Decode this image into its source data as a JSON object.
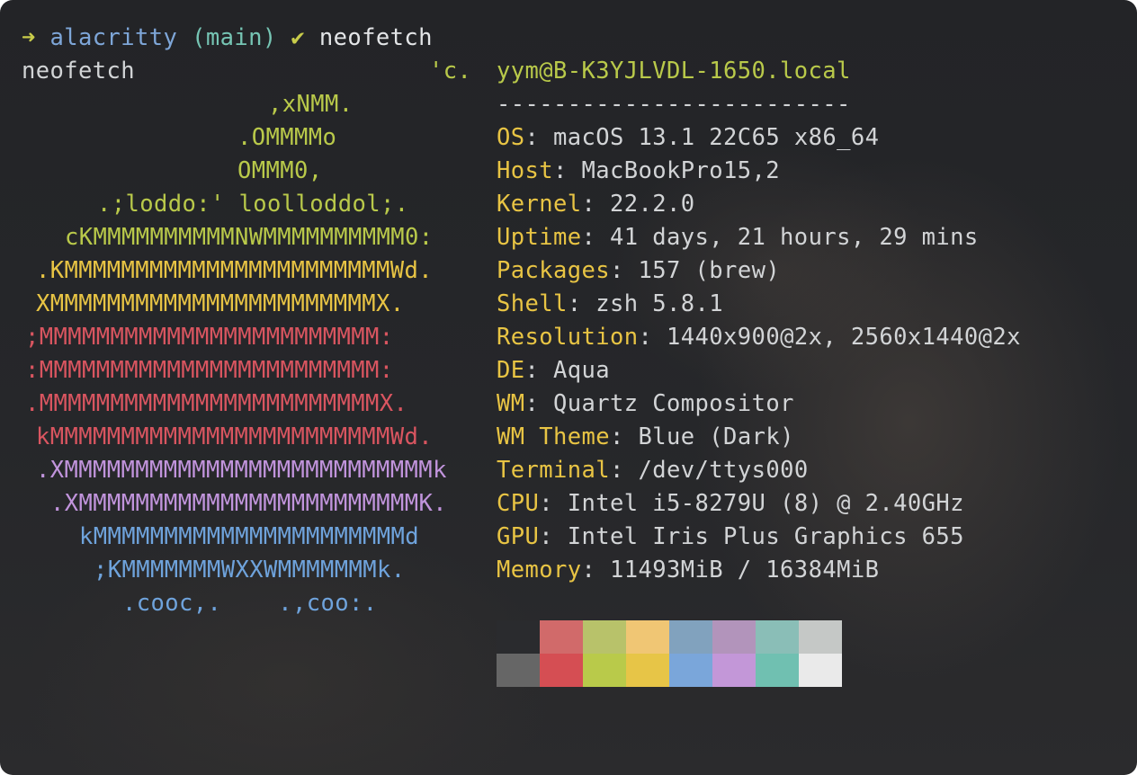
{
  "prompt": {
    "arrow": "➜",
    "directory": "alacritty",
    "branch": "(main)",
    "check": "✔",
    "command": "neofetch"
  },
  "echo_line": "neofetch",
  "ascii_art": [
    {
      "text": "'c.",
      "color": "green"
    },
    {
      "text": ",xNMM.",
      "color": "green"
    },
    {
      "text": ".OMMMMo",
      "color": "green"
    },
    {
      "text": "OMMM0,",
      "color": "green"
    },
    {
      "text": ".;loddo:' loolloddol;.",
      "color": "green"
    },
    {
      "text": "cKMMMMMMMMMMNWMMMMMMMMMM0:",
      "color": "green"
    },
    {
      "text": ".KMMMMMMMMMMMMMMMMMMMMMMMWd.",
      "color": "yellow"
    },
    {
      "text": "XMMMMMMMMMMMMMMMMMMMMMMMX.",
      "color": "yellow"
    },
    {
      "text": ";MMMMMMMMMMMMMMMMMMMMMMMM:",
      "color": "red"
    },
    {
      "text": ":MMMMMMMMMMMMMMMMMMMMMMMM:",
      "color": "red"
    },
    {
      "text": ".MMMMMMMMMMMMMMMMMMMMMMMMX.",
      "color": "red"
    },
    {
      "text": "kMMMMMMMMMMMMMMMMMMMMMMMMWd.",
      "color": "red"
    },
    {
      "text": ".XMMMMMMMMMMMMMMMMMMMMMMMMMMk",
      "color": "purple"
    },
    {
      "text": ".XMMMMMMMMMMMMMMMMMMMMMMMMK.",
      "color": "purple"
    },
    {
      "text": "kMMMMMMMMMMMMMMMMMMMMMMd",
      "color": "blue"
    },
    {
      "text": ";KMMMMMMMWXXWMMMMMMMk.",
      "color": "blue"
    },
    {
      "text": ".cooc,.    .,coo:.",
      "color": "blue"
    }
  ],
  "info": {
    "user_host": "yym@B-K3YJLVDL-1650.local",
    "separator": "-------------------------",
    "fields": [
      {
        "key": "OS",
        "value": "macOS 13.1 22C65 x86_64"
      },
      {
        "key": "Host",
        "value": "MacBookPro15,2"
      },
      {
        "key": "Kernel",
        "value": "22.2.0"
      },
      {
        "key": "Uptime",
        "value": "41 days, 21 hours, 29 mins"
      },
      {
        "key": "Packages",
        "value": "157 (brew)"
      },
      {
        "key": "Shell",
        "value": "zsh 5.8.1"
      },
      {
        "key": "Resolution",
        "value": "1440x900@2x, 2560x1440@2x"
      },
      {
        "key": "DE",
        "value": "Aqua"
      },
      {
        "key": "WM",
        "value": "Quartz Compositor"
      },
      {
        "key": "WM Theme",
        "value": "Blue (Dark)"
      },
      {
        "key": "Terminal",
        "value": "/dev/ttys000"
      },
      {
        "key": "CPU",
        "value": "Intel i5-8279U (8) @ 2.40GHz"
      },
      {
        "key": "GPU",
        "value": "Intel Iris Plus Graphics 655"
      },
      {
        "key": "Memory",
        "value": "11493MiB / 16384MiB"
      }
    ]
  },
  "palette": {
    "top": [
      "#2a2b2e",
      "#d16a6a",
      "#b8c26a",
      "#f0c674",
      "#81a2be",
      "#b294bb",
      "#8abeb7",
      "#c5c8c6"
    ],
    "bottom": [
      "#666666",
      "#d54e53",
      "#b9ca4a",
      "#e7c547",
      "#7aa6da",
      "#c397d8",
      "#70c0b1",
      "#eaeaea"
    ]
  },
  "colors": {
    "green": "#b9c94a",
    "yellow": "#e8c444",
    "red": "#d95560",
    "purple": "#c194dc",
    "blue": "#6fa3dc"
  }
}
